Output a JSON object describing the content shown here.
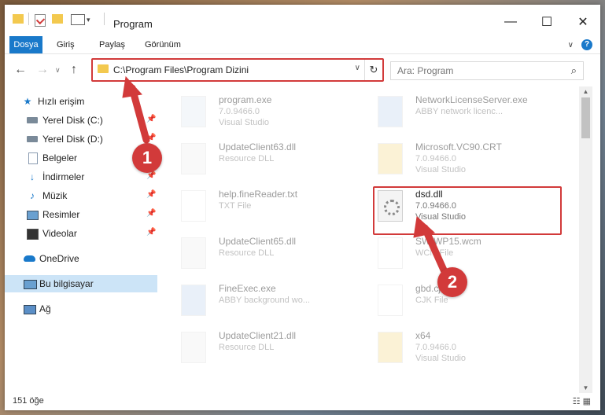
{
  "window": {
    "title": "Program",
    "minimize_glyph": "—",
    "maximize_glyph": "☐",
    "close_glyph": "✕"
  },
  "ribbon": {
    "tabs": [
      "Dosya",
      "Giriş",
      "Paylaş",
      "Görünüm"
    ],
    "expand_glyph": "∨",
    "help_glyph": "?"
  },
  "address": {
    "path": "C:\\Program Files\\Program Dizini",
    "refresh_glyph": "↻",
    "dropdown_glyph": "∨"
  },
  "search": {
    "placeholder": "Ara: Program"
  },
  "sidebar": {
    "items": [
      {
        "label": "Hızlı erişim",
        "icon": "star-icon"
      },
      {
        "label": "Yerel Disk (C:)",
        "icon": "drive-icon"
      },
      {
        "label": "Yerel Disk (D:)",
        "icon": "drive-icon"
      },
      {
        "label": "Belgeler",
        "icon": "documents-icon"
      },
      {
        "label": "İndirmeler",
        "icon": "download-icon"
      },
      {
        "label": "Müzik",
        "icon": "music-icon"
      },
      {
        "label": "Resimler",
        "icon": "pictures-icon"
      },
      {
        "label": "Videolar",
        "icon": "video-icon"
      },
      {
        "label": "OneDrive",
        "icon": "cloud-icon"
      },
      {
        "label": "Bu bilgisayar",
        "icon": "computer-icon"
      },
      {
        "label": "Ağ",
        "icon": "network-icon"
      }
    ]
  },
  "files": [
    {
      "name": "program.exe",
      "line1": "7.0.9466.0",
      "line2": "Visual Studio"
    },
    {
      "name": "NetworkLicenseServer.exe",
      "line1": "ABBY network licenc...",
      "line2": ""
    },
    {
      "name": "UpdateClient63.dll",
      "line1": "Resource DLL",
      "line2": ""
    },
    {
      "name": "Microsoft.VC90.CRT",
      "line1": "7.0.9466.0",
      "line2": "Visual Studio"
    },
    {
      "name": "help.fineReader.txt",
      "line1": "TXT File",
      "line2": ""
    },
    {
      "name": "dsd.dll",
      "line1": "7.0.9466.0",
      "line2": "Visual Studio"
    },
    {
      "name": "UpdateClient65.dll",
      "line1": "Resource DLL",
      "line2": ""
    },
    {
      "name": "SW-WP15.wcm",
      "line1": "WCM File",
      "line2": ""
    },
    {
      "name": "FineExec.exe",
      "line1": "ABBY background wo...",
      "line2": ""
    },
    {
      "name": "gbd.cjk",
      "line1": "CJK File",
      "line2": ""
    },
    {
      "name": "UpdateClient21.dll",
      "line1": "Resource DLL",
      "line2": ""
    },
    {
      "name": "x64",
      "line1": "7.0.9466.0",
      "line2": "Visual Studio"
    }
  ],
  "status": {
    "count": "151 öğe"
  },
  "annotations": {
    "step1": "1",
    "step2": "2",
    "color": "#d23a3a"
  }
}
